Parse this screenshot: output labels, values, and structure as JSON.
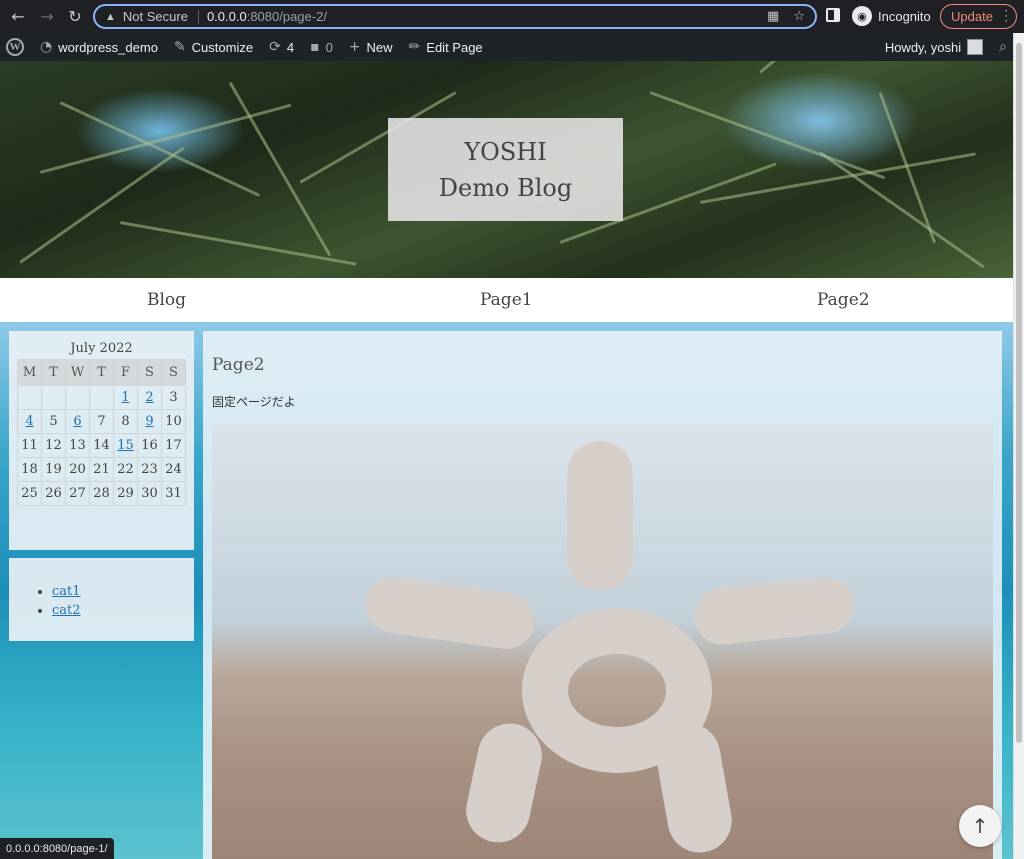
{
  "browser": {
    "back_icon": "←",
    "forward_icon": "→",
    "reload_icon": "↻",
    "security_text": "Not Secure",
    "url_host": "0.0.0.0",
    "url_rest": ":8080/page-2/",
    "incognito_label": "Incognito",
    "update_label": "Update"
  },
  "adminbar": {
    "site_name": "wordpress_demo",
    "customize": "Customize",
    "updates_count": "4",
    "comments_count": "0",
    "new": "New",
    "edit_page": "Edit Page",
    "howdy": "Howdy, yoshi"
  },
  "header": {
    "title_line1": "YOSHI",
    "title_line2": "Demo Blog"
  },
  "menu": {
    "items": [
      {
        "label": "Blog"
      },
      {
        "label": "Page1"
      },
      {
        "label": "Page2"
      }
    ]
  },
  "calendar": {
    "caption": "July 2022",
    "weekdays": [
      "M",
      "T",
      "W",
      "T",
      "F",
      "S",
      "S"
    ],
    "linked_days": [
      1,
      2,
      4,
      6,
      9,
      15
    ]
  },
  "categories": {
    "items": [
      {
        "label": "cat1"
      },
      {
        "label": "cat2"
      }
    ]
  },
  "page": {
    "title": "Page2",
    "text": "固定ページだよ"
  },
  "back_to_top_icon": "↑",
  "status_url": "0.0.0.0:8080/page-1/"
}
